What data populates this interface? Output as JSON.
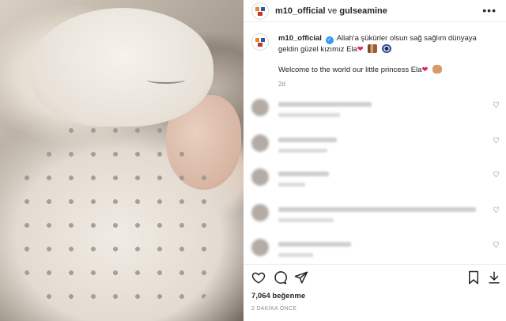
{
  "header": {
    "username": "m10_official",
    "connector": "ve",
    "collaborator": "gulseamine"
  },
  "caption": {
    "username": "m10_official",
    "text_turkish": "Allah'a şükürler olsun sağ sağlım dünyaya geldin güzel kızımız Ela",
    "text_english": "Welcome to the world our little princess Ela",
    "time_ago": "2d"
  },
  "comments": [
    {
      "heart": "♡"
    },
    {
      "heart": "♡"
    },
    {
      "heart": "♡"
    },
    {
      "heart": "♡"
    },
    {
      "heart": "♡"
    }
  ],
  "engagement": {
    "likes": "7,064 beğenme",
    "posted": "2 DAKİKA ÖNCE"
  },
  "icons": {
    "more": "more-options-icon",
    "like": "heart-icon",
    "comment": "comment-icon",
    "share": "share-icon",
    "save": "bookmark-icon",
    "download": "download-icon"
  },
  "colors": {
    "verified": "#3897f0",
    "text": "#262626",
    "muted": "#8e8e8e",
    "heart": "#e0245e"
  }
}
